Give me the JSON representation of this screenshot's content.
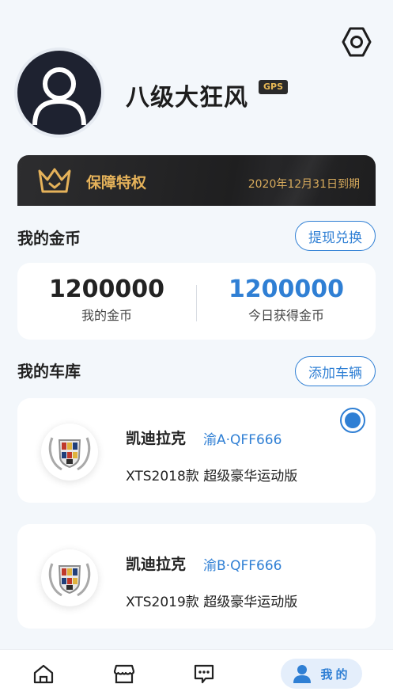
{
  "profile": {
    "username": "八级大狂风",
    "badge": "GPS"
  },
  "vip": {
    "title": "保障特权",
    "expire": "2020年12月31日到期"
  },
  "coins": {
    "section_title": "我的金币",
    "action_label": "提现兑换",
    "my_coins_value": "1200000",
    "my_coins_label": "我的金币",
    "today_value": "1200000",
    "today_label": "今日获得金币"
  },
  "garage": {
    "section_title": "我的车库",
    "action_label": "添加车辆",
    "cars": [
      {
        "brand": "凯迪拉克",
        "plate": "渝A·QFF666",
        "model": "XTS2018款 超级豪华运动版",
        "selected": true
      },
      {
        "brand": "凯迪拉克",
        "plate": "渝B·QFF666",
        "model": "XTS2019款 超级豪华运动版",
        "selected": false
      }
    ]
  },
  "tabbar": {
    "items": [
      "home-icon",
      "store-icon",
      "message-icon",
      "user-icon"
    ],
    "active_label": "我的"
  },
  "colors": {
    "accent": "#2f7fd4",
    "gold": "#e5b25a",
    "background": "#f3f7fb"
  }
}
